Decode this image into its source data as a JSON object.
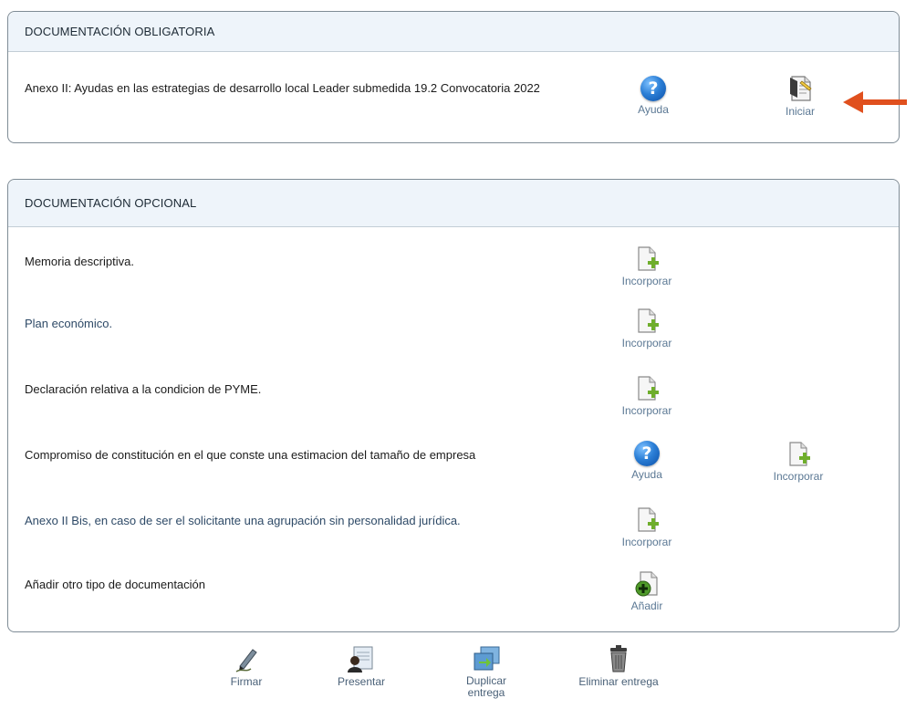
{
  "obligatoria": {
    "header": "DOCUMENTACIÓN OBLIGATORIA",
    "item": {
      "label": "Anexo II: Ayudas en las estrategias de desarrollo local Leader submedida 19.2 Convocatoria 2022",
      "help_label": "Ayuda",
      "start_label": "Iniciar"
    }
  },
  "opcional": {
    "header": "DOCUMENTACIÓN OPCIONAL",
    "items": [
      {
        "label": "Memoria descriptiva.",
        "action_label": "Incorporar"
      },
      {
        "label": "Plan económico.",
        "action_label": "Incorporar"
      },
      {
        "label": "Declaración relativa a la condicion de PYME.",
        "action_label": "Incorporar"
      },
      {
        "label": "Compromiso de constitución en el que conste una estimacion del tamaño de empresa",
        "help_label": "Ayuda",
        "action_label": "Incorporar"
      },
      {
        "label": "Anexo II Bis, en caso de ser el solicitante una agrupación sin personalidad jurídica.",
        "action_label": "Incorporar"
      },
      {
        "label": "Añadir otro tipo de documentación",
        "action_label": "Añadir"
      }
    ]
  },
  "toolbar": {
    "sign_label": "Firmar",
    "present_label": "Presentar",
    "duplicate_label": "Duplicar entrega",
    "delete_label": "Eliminar entrega"
  },
  "colors": {
    "header_bg": "#eef4fa",
    "border": "#7f8c96",
    "link_text": "#5b7894",
    "arrow": "#e0501e",
    "help_blue": "#2c7fd6",
    "add_green": "#7bb33a"
  },
  "icons": {
    "help": "help-icon",
    "start": "form-start-icon",
    "incorporate": "document-add-icon",
    "add": "document-plus-icon",
    "sign": "pen-icon",
    "present": "present-icon",
    "duplicate": "duplicate-icon",
    "delete": "trash-icon",
    "pointer": "arrow-left-icon"
  }
}
